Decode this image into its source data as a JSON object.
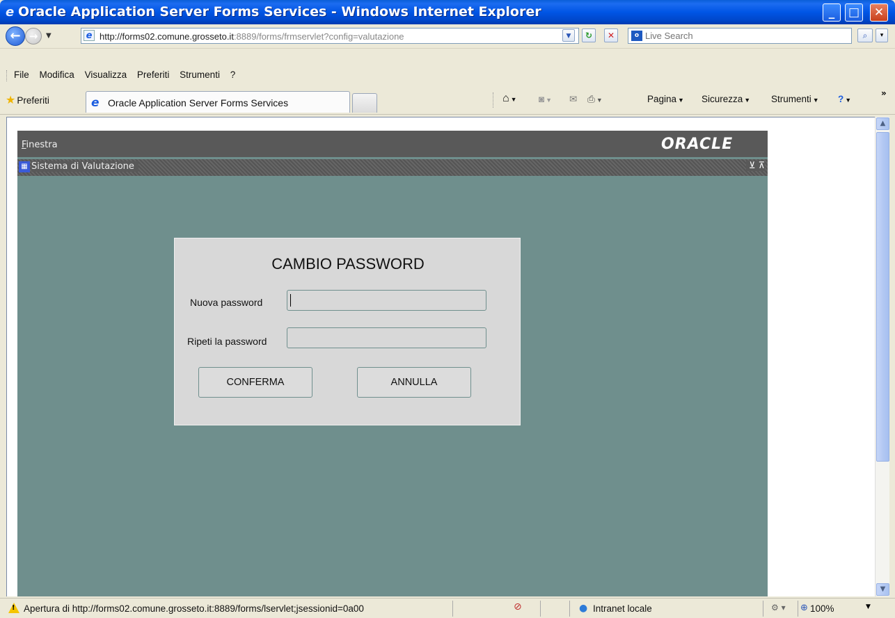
{
  "window": {
    "title": "Oracle Application Server Forms Services - Windows Internet Explorer",
    "icon": "ie-icon"
  },
  "address": {
    "url_host": "http://forms02.comune.grosseto.it",
    "url_rest": ":8889/forms/frmservlet?config=valutazione",
    "search_placeholder": "Live Search"
  },
  "menubar": {
    "items": [
      "File",
      "Modifica",
      "Visualizza",
      "Preferiti",
      "Strumenti",
      "?"
    ]
  },
  "tabs": {
    "favorites_label": "Preferiti",
    "active_tab": "Oracle Application Server Forms Services"
  },
  "commandbar": {
    "page": "Pagina",
    "security": "Sicurezza",
    "tools": "Strumenti"
  },
  "forms": {
    "menu": "Finestra",
    "logo": "ORACLE",
    "window_title": "Sistema di Valutazione"
  },
  "dialog": {
    "title": "CAMBIO PASSWORD",
    "new_password_label": "Nuova password",
    "repeat_password_label": "Ripeti la password",
    "new_password_value": "",
    "repeat_password_value": "",
    "confirm_label": "CONFERMA",
    "cancel_label": "ANNULLA"
  },
  "status": {
    "text": "Apertura di http://forms02.comune.grosseto.it:8889/forms/lservlet;jsessionid=0a00",
    "zone": "Intranet locale",
    "zoom": "100%"
  },
  "colors": {
    "forms_background": "#6f8f8d",
    "forms_bar": "#595959",
    "dialog_background": "#d8d8d8",
    "xp_titlebar": "#0055e5"
  }
}
